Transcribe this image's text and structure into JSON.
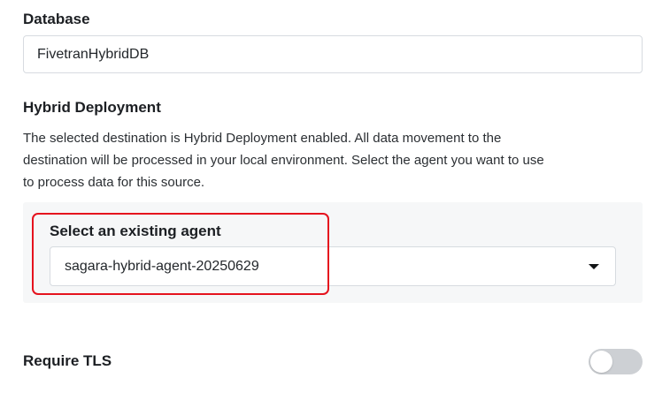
{
  "database": {
    "label": "Database",
    "value": "FivetranHybridDB"
  },
  "hybrid_deployment": {
    "heading": "Hybrid Deployment",
    "description_lines": [
      "The selected destination is Hybrid Deployment enabled. All data movement to the",
      "destination will be processed in your local environment. Select the agent you want to use",
      "to process data for this source."
    ],
    "agent": {
      "label": "Select an existing agent",
      "selected_value": "sagara-hybrid-agent-20250629"
    }
  },
  "tls": {
    "label": "Require TLS",
    "enabled": false
  },
  "colors": {
    "highlight": "#e5131e",
    "panel_background": "#f6f7f8",
    "toggle_off": "#cdd0d4"
  },
  "icons": {
    "dropdown": "caret-down-icon"
  }
}
